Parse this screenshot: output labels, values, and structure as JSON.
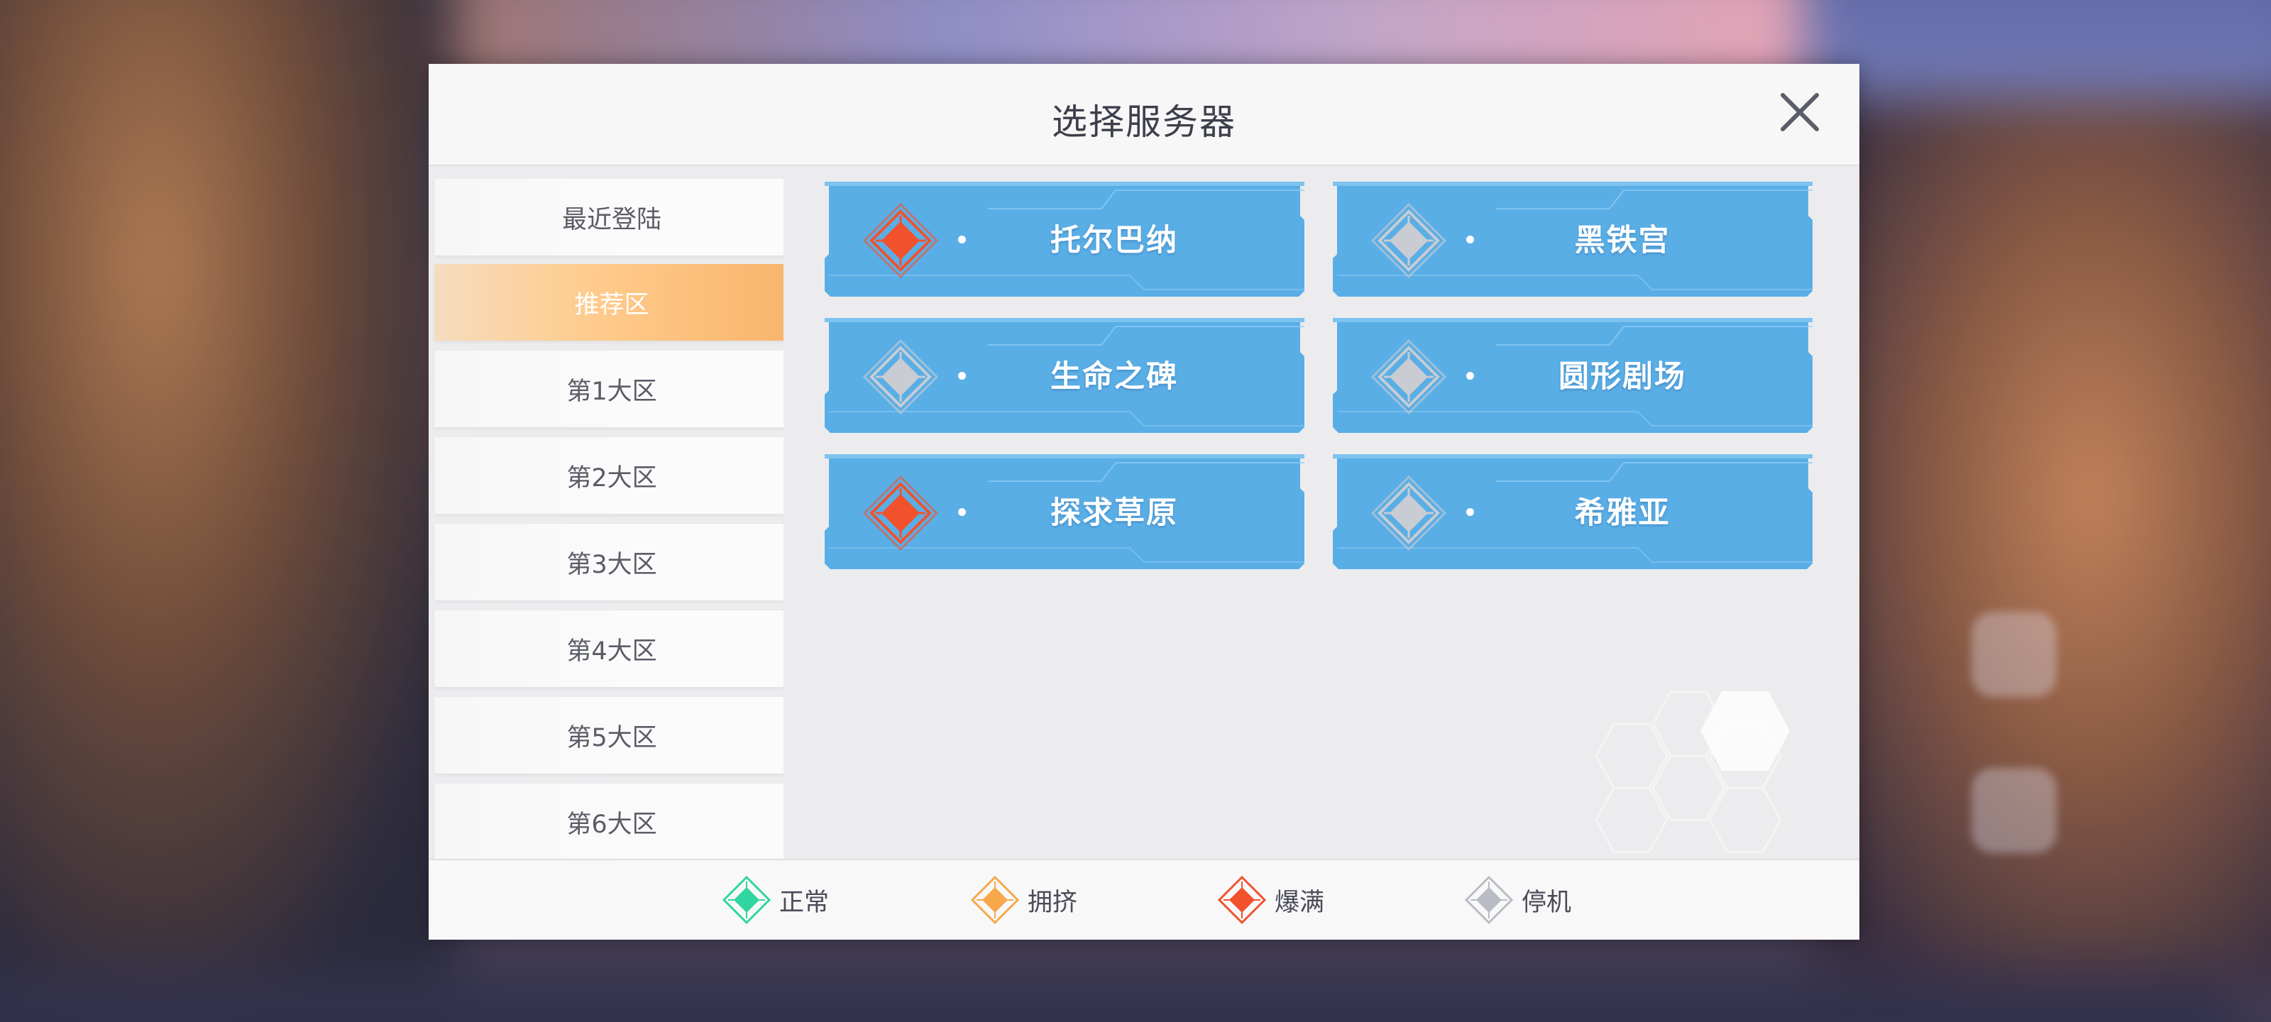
{
  "dialog": {
    "title": "选择服务器",
    "close_icon": "close-icon"
  },
  "sidebar": {
    "items": [
      {
        "label": "最近登陆",
        "active": false
      },
      {
        "label": "推荐区",
        "active": true
      },
      {
        "label": "第1大区",
        "active": false
      },
      {
        "label": "第2大区",
        "active": false
      },
      {
        "label": "第3大区",
        "active": false
      },
      {
        "label": "第4大区",
        "active": false
      },
      {
        "label": "第5大区",
        "active": false
      },
      {
        "label": "第6大区",
        "active": false
      }
    ]
  },
  "servers": [
    {
      "name": "托尔巴纳",
      "status": "爆满"
    },
    {
      "name": "黑铁宫",
      "status": "停机"
    },
    {
      "name": "生命之碑",
      "status": "停机"
    },
    {
      "name": "圆形剧场",
      "status": "停机"
    },
    {
      "name": "探求草原",
      "status": "爆满"
    },
    {
      "name": "希雅亚",
      "status": "停机"
    }
  ],
  "legend": [
    {
      "label": "正常",
      "color": "#2fd6a0"
    },
    {
      "label": "拥挤",
      "color": "#f7a84a"
    },
    {
      "label": "爆满",
      "color": "#f1522d"
    },
    {
      "label": "停机",
      "color": "#b9bcc4"
    }
  ],
  "colors": {
    "server_card": "#5aaee6",
    "active_tab": "#f8b56c",
    "status_full": "#f1522d",
    "status_offline": "#c9ccd3"
  }
}
